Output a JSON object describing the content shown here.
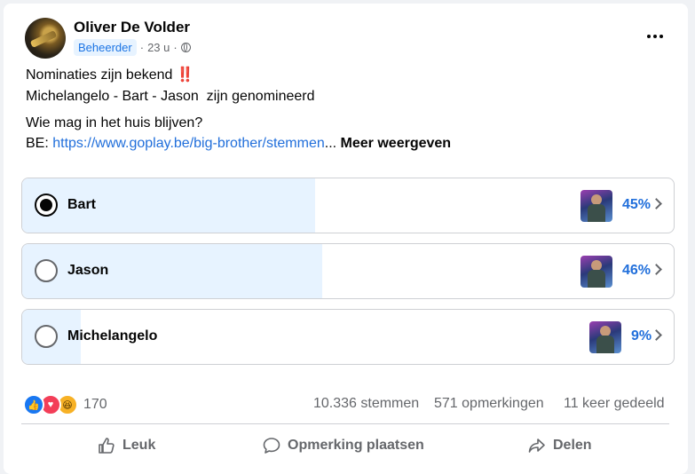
{
  "post": {
    "author": "Oliver De Volder",
    "role_badge": "Beheerder",
    "time": "23 u",
    "time_separator": "·",
    "line1": "Nominaties zijn bekend",
    "line1_emoji": "‼️",
    "line2": "Michelangelo - Bart - Jason  zijn genomineerd",
    "line3": "Wie mag in het huis blijven?",
    "line4_prefix": "BE: ",
    "line4_link": "https://www.goplay.be/big-brother/stemmen",
    "line4_ellipsis": "...",
    "see_more": "Meer weergeven"
  },
  "poll": {
    "options": [
      {
        "label": "Bart",
        "percent_text": "45%",
        "percent": 45,
        "selected": true
      },
      {
        "label": "Jason",
        "percent_text": "46%",
        "percent": 46,
        "selected": false
      },
      {
        "label": "Michelangelo",
        "percent_text": "9%",
        "percent": 9,
        "selected": false
      }
    ]
  },
  "footer": {
    "reaction_count": "170",
    "votes": "10.336 stemmen",
    "comments": "571 opmerkingen",
    "shares": "11 keer gedeeld",
    "like_label": "Leuk",
    "comment_label": "Opmerking plaatsen",
    "share_label": "Delen"
  },
  "icons": {
    "more": "more-options-icon",
    "globe": "globe-icon",
    "like": "like-icon",
    "comment": "comment-icon",
    "share": "share-icon"
  },
  "colors": {
    "accent": "#216fdb",
    "poll_fill": "#e7f3ff",
    "muted": "#65676b"
  }
}
